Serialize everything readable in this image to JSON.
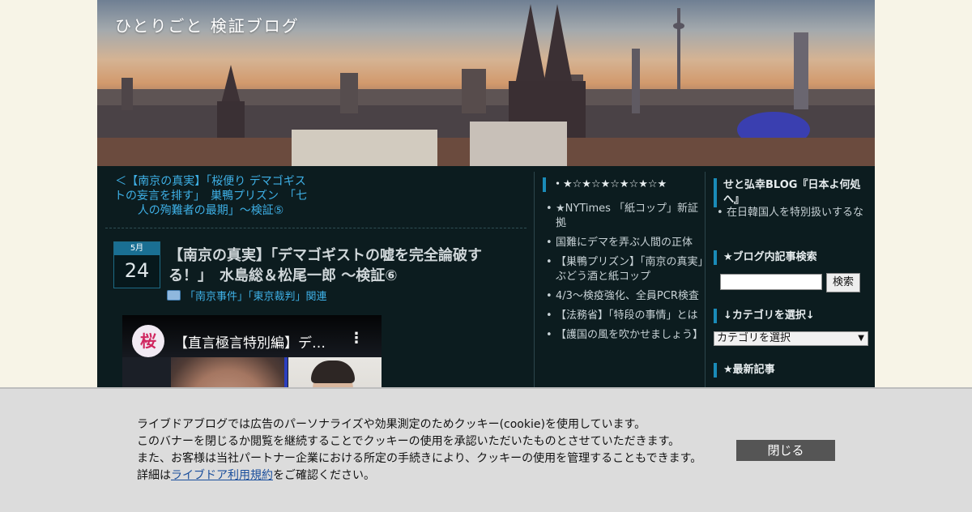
{
  "blog": {
    "title": "ひとりごと 検証ブログ"
  },
  "nav": {
    "prev_label": "＜【南京の真実】「桜便り デマゴギストの妄言を排す」　巣鴨プリズン　「七人の殉難者の最期」～検証⑤"
  },
  "post": {
    "month": "5月",
    "day": "24",
    "title": "【南京の真実】「デマゴギストの嘘を完全論破する！」　水島総＆松尾一郎 ～検証⑥",
    "category": "「南京事件」「東京裁判」関連"
  },
  "video": {
    "channel_logo_text": "桜",
    "title": "【直言極言特別編】デ…",
    "more": "⋮"
  },
  "sidebar_mid": {
    "heading": "・★☆★☆★☆★☆★☆★",
    "items": [
      "★NYTimes 「紙コップ」新証拠",
      "国難にデマを弄ぶ人間の正体",
      "【巣鴨プリズン】「南京の真実」ぶどう酒と紙コップ",
      "4/3～検疫強化、全員PCR検査",
      "【法務省】「特段の事情」とは",
      "【護国の風を吹かせましょう】"
    ]
  },
  "sidebar_right": {
    "blog_heading": "せと弘幸BLOG『日本よ何処へ』",
    "blog_items": [
      "在日韓国人を特別扱いするな"
    ],
    "search_heading": "★ブログ内記事検索",
    "search_value": "",
    "search_button": "検索",
    "category_heading": "↓カテゴリを選択↓",
    "category_select": "カテゴリを選択",
    "latest_heading": "★最新記事"
  },
  "cookie": {
    "line1": "ライブドアブログでは広告のパーソナライズや効果測定のためクッキー(cookie)を使用しています。",
    "line2": "このバナーを閉じるか閲覧を継続することでクッキーの使用を承認いただいたものとさせていただきます。",
    "line3": "また、お客様は当社パートナー企業における所定の手続きにより、クッキーの使用を管理することもできます。",
    "line4_prefix": "詳細は",
    "line4_link": "ライブドア利用規約",
    "line4_suffix": "をご確認ください。",
    "close_label": "閉じる"
  },
  "colors": {
    "background": "#f7f4e7",
    "page": "#0c1c1f",
    "link": "#3eb0e6",
    "accent": "#1a8bb8",
    "close_button": "#555555"
  }
}
